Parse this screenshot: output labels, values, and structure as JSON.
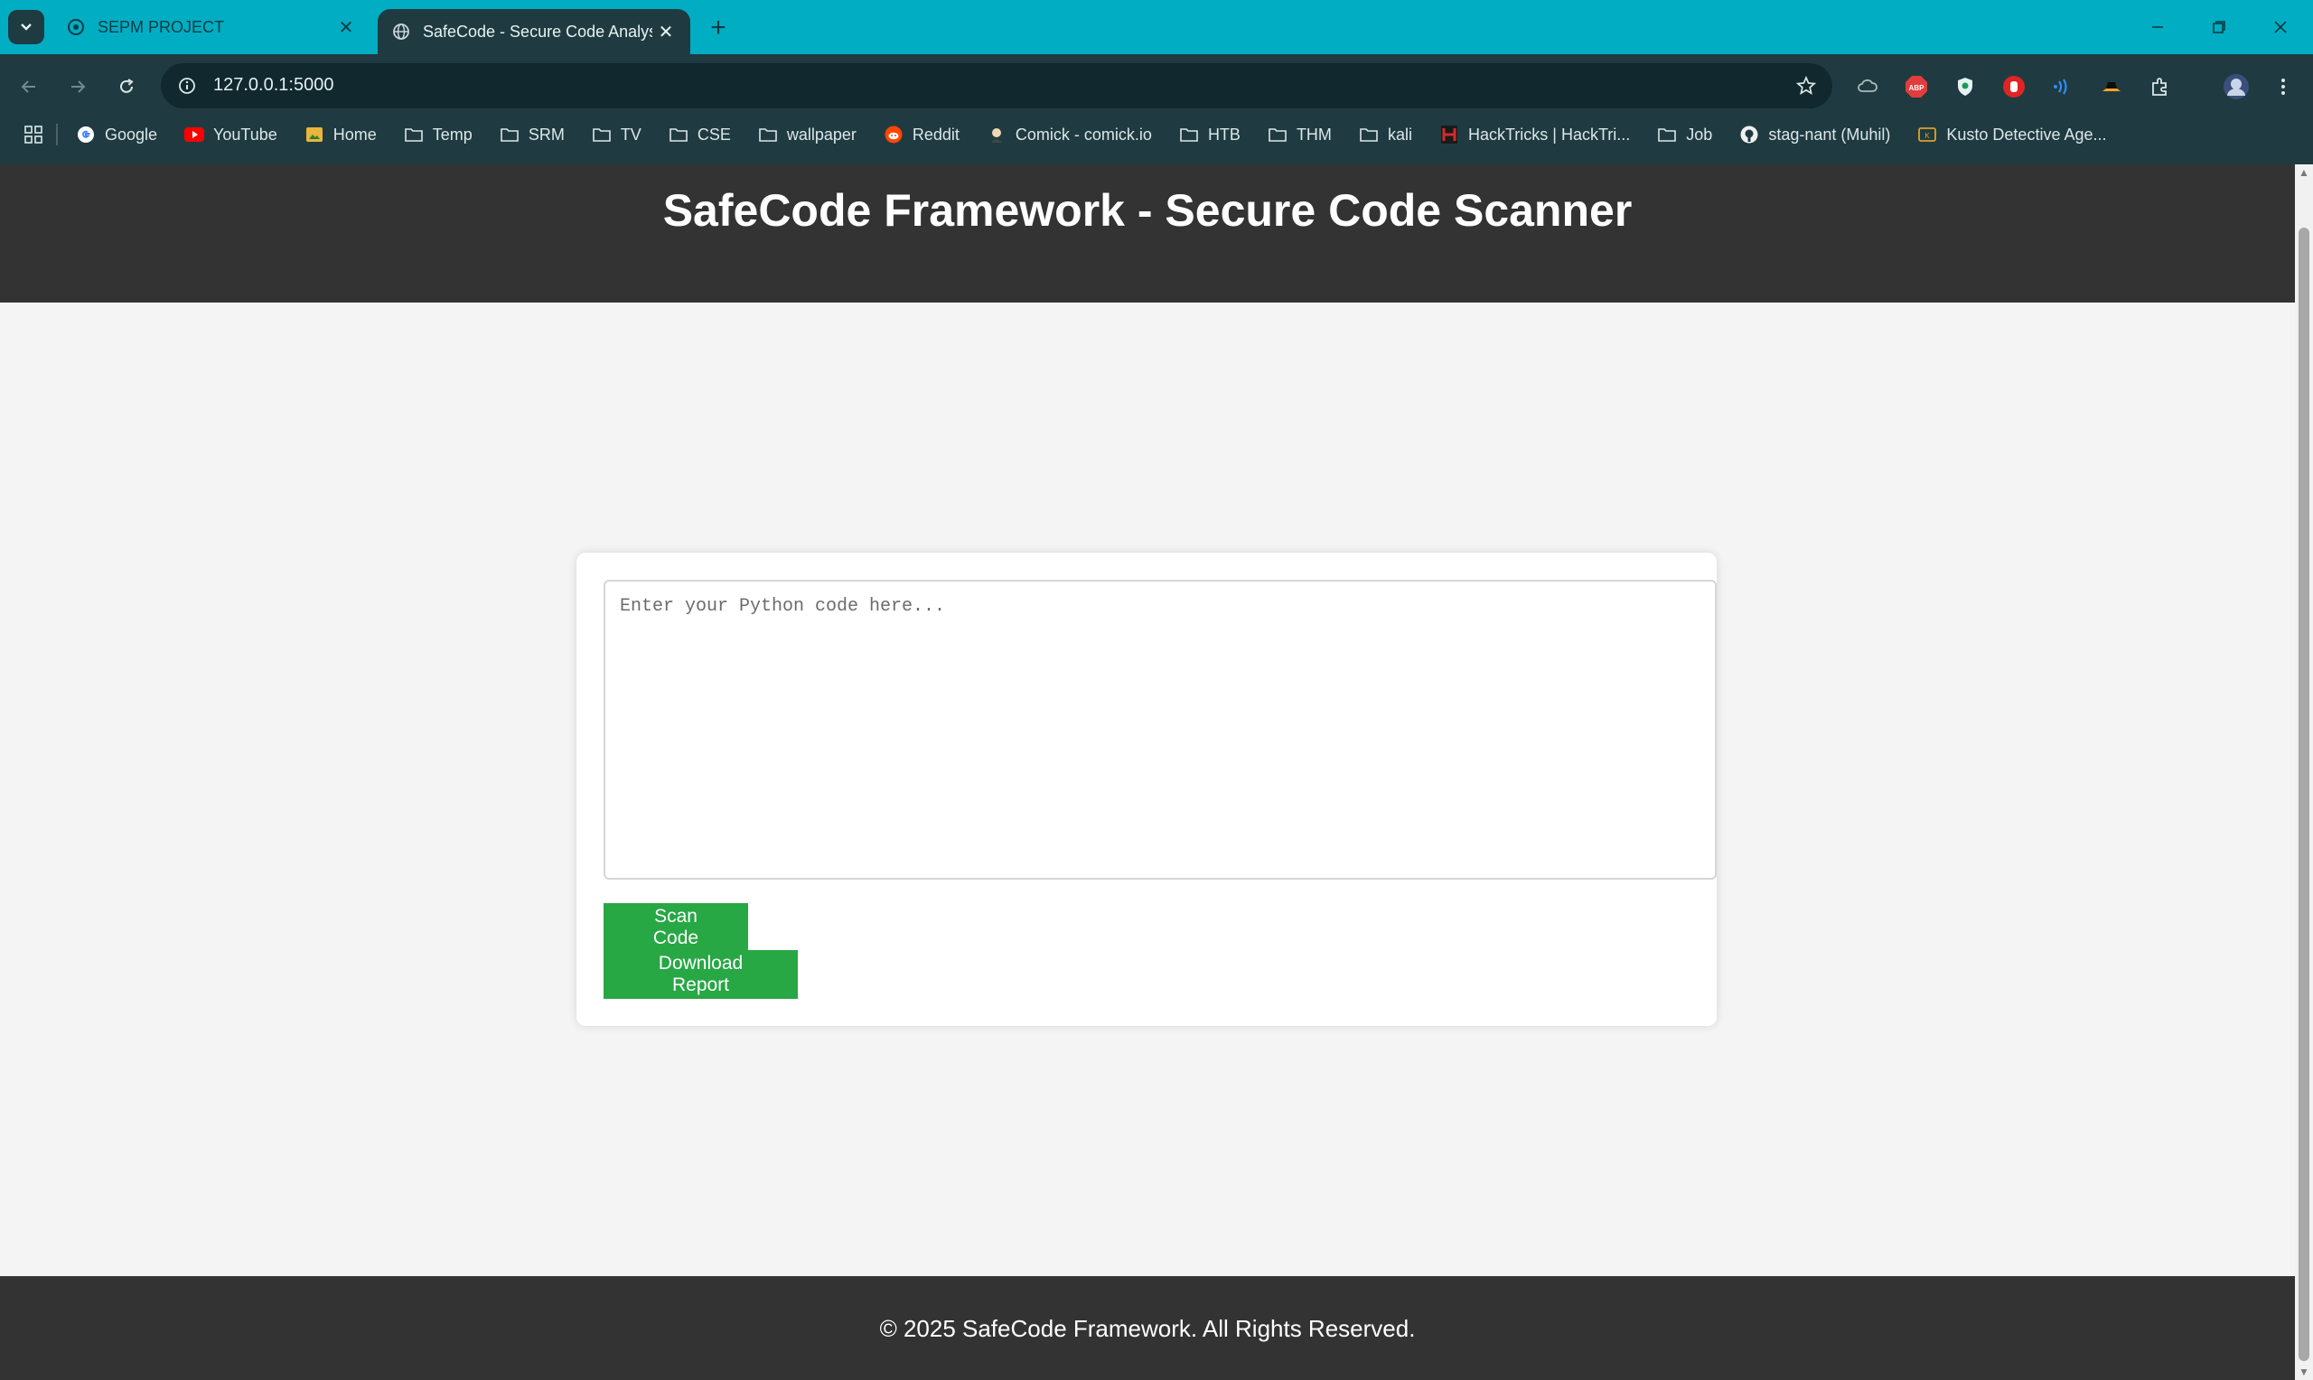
{
  "browser": {
    "tabs": [
      {
        "title": "SEPM PROJECT",
        "active": false
      },
      {
        "title": "SafeCode - Secure Code Analys",
        "active": true
      }
    ],
    "address": "127.0.0.1:5000",
    "bookmarks": [
      {
        "label": "Google",
        "icon": "google-icon"
      },
      {
        "label": "YouTube",
        "icon": "youtube-icon"
      },
      {
        "label": "Home",
        "icon": "home-icon"
      },
      {
        "label": "Temp",
        "icon": "folder-icon"
      },
      {
        "label": "SRM",
        "icon": "folder-icon"
      },
      {
        "label": "TV",
        "icon": "folder-icon"
      },
      {
        "label": "CSE",
        "icon": "folder-icon"
      },
      {
        "label": "wallpaper",
        "icon": "folder-icon"
      },
      {
        "label": "Reddit",
        "icon": "reddit-icon"
      },
      {
        "label": "Comick - comick.io",
        "icon": "comick-icon"
      },
      {
        "label": "HTB",
        "icon": "folder-icon"
      },
      {
        "label": "THM",
        "icon": "folder-icon"
      },
      {
        "label": "kali",
        "icon": "folder-icon"
      },
      {
        "label": "HackTricks | HackTri...",
        "icon": "hacktricks-icon"
      },
      {
        "label": "Job",
        "icon": "folder-icon"
      },
      {
        "label": "stag-nant (Muhil)",
        "icon": "github-icon"
      },
      {
        "label": "Kusto Detective Age...",
        "icon": "kusto-icon"
      }
    ],
    "colors": {
      "tabstrip": "#00adc3",
      "toolbar": "#1f3b41"
    }
  },
  "page": {
    "title": "SafeCode Framework - Secure Code Scanner",
    "code_placeholder": "Enter your Python code here...",
    "scan_button": "Scan Code",
    "download_button": "Download Report",
    "footer": "© 2025 SafeCode Framework. All Rights Reserved.",
    "colors": {
      "header": "#333333",
      "button": "#28a745",
      "background": "#f4f4f4"
    }
  }
}
